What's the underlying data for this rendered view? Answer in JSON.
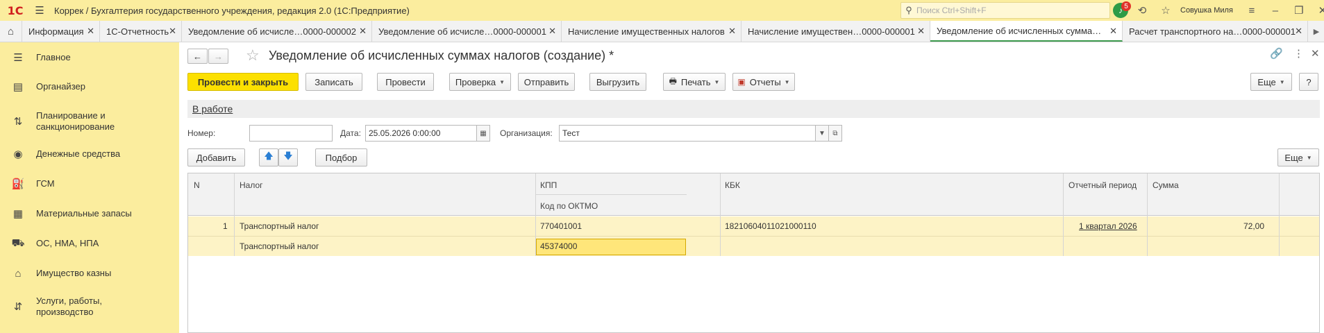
{
  "window": {
    "logo": "1С",
    "title": "Коррек / Бухгалтерия государственного учреждения, редакция 2.0  (1С:Предприятие)",
    "search_placeholder": "Поиск Ctrl+Shift+F",
    "notification_count": "5",
    "user": "Совушка Миля"
  },
  "tabs": [
    {
      "label": "Информация"
    },
    {
      "label": "1С-Отчетность"
    },
    {
      "label": "Уведомление об исчисле…0000-000002"
    },
    {
      "label": "Уведомление об исчисле…0000-000001"
    },
    {
      "label": "Начисление имущественных налогов"
    },
    {
      "label": "Начисление имуществен…0000-000001"
    },
    {
      "label": "Уведомление об исчисленных сумма…"
    },
    {
      "label": "Расчет транспортного на…0000-000001"
    }
  ],
  "sidebar": {
    "items": [
      {
        "label": "Главное",
        "icon": "menu-icon"
      },
      {
        "label": "Органайзер",
        "icon": "clipboard-icon"
      },
      {
        "label": "Планирование и санкционирование",
        "icon": "planning-icon"
      },
      {
        "label": "Денежные средства",
        "icon": "money-icon"
      },
      {
        "label": "ГСМ",
        "icon": "fuel-icon"
      },
      {
        "label": "Материальные запасы",
        "icon": "inventory-icon"
      },
      {
        "label": "ОС, НМА, НПА",
        "icon": "truck-icon"
      },
      {
        "label": "Имущество казны",
        "icon": "treasury-icon"
      },
      {
        "label": "Услуги, работы, производство",
        "icon": "production-icon"
      }
    ]
  },
  "document": {
    "title": "Уведомление об исчисленных суммах налогов (создание) *",
    "status": "В работе",
    "toolbar": {
      "post_close": "Провести и закрыть",
      "save": "Записать",
      "post": "Провести",
      "check": "Проверка",
      "send": "Отправить",
      "export": "Выгрузить",
      "print": "Печать",
      "reports": "Отчеты",
      "more": "Еще",
      "help": "?"
    },
    "fields": {
      "number_label": "Номер:",
      "number_value": "",
      "date_label": "Дата:",
      "date_value": "25.05.2026  0:00:00",
      "org_label": "Организация:",
      "org_value": "Тест"
    },
    "table_toolbar": {
      "add": "Добавить",
      "pick": "Подбор",
      "more": "Еще"
    },
    "table": {
      "headers": {
        "n": "N",
        "tax": "Налог",
        "kpp": "КПП",
        "oktmo": "Код по ОКТМО",
        "kbk": "КБК",
        "period": "Отчетный период",
        "sum": "Сумма"
      },
      "rows": [
        {
          "n": "1",
          "tax": "Транспортный налог",
          "tax2": "Транспортный налог",
          "kpp": "770401001",
          "oktmo": "45374000",
          "kbk": "18210604011021000110",
          "period": "1 квартал 2026",
          "sum": "72,00"
        }
      ]
    }
  }
}
